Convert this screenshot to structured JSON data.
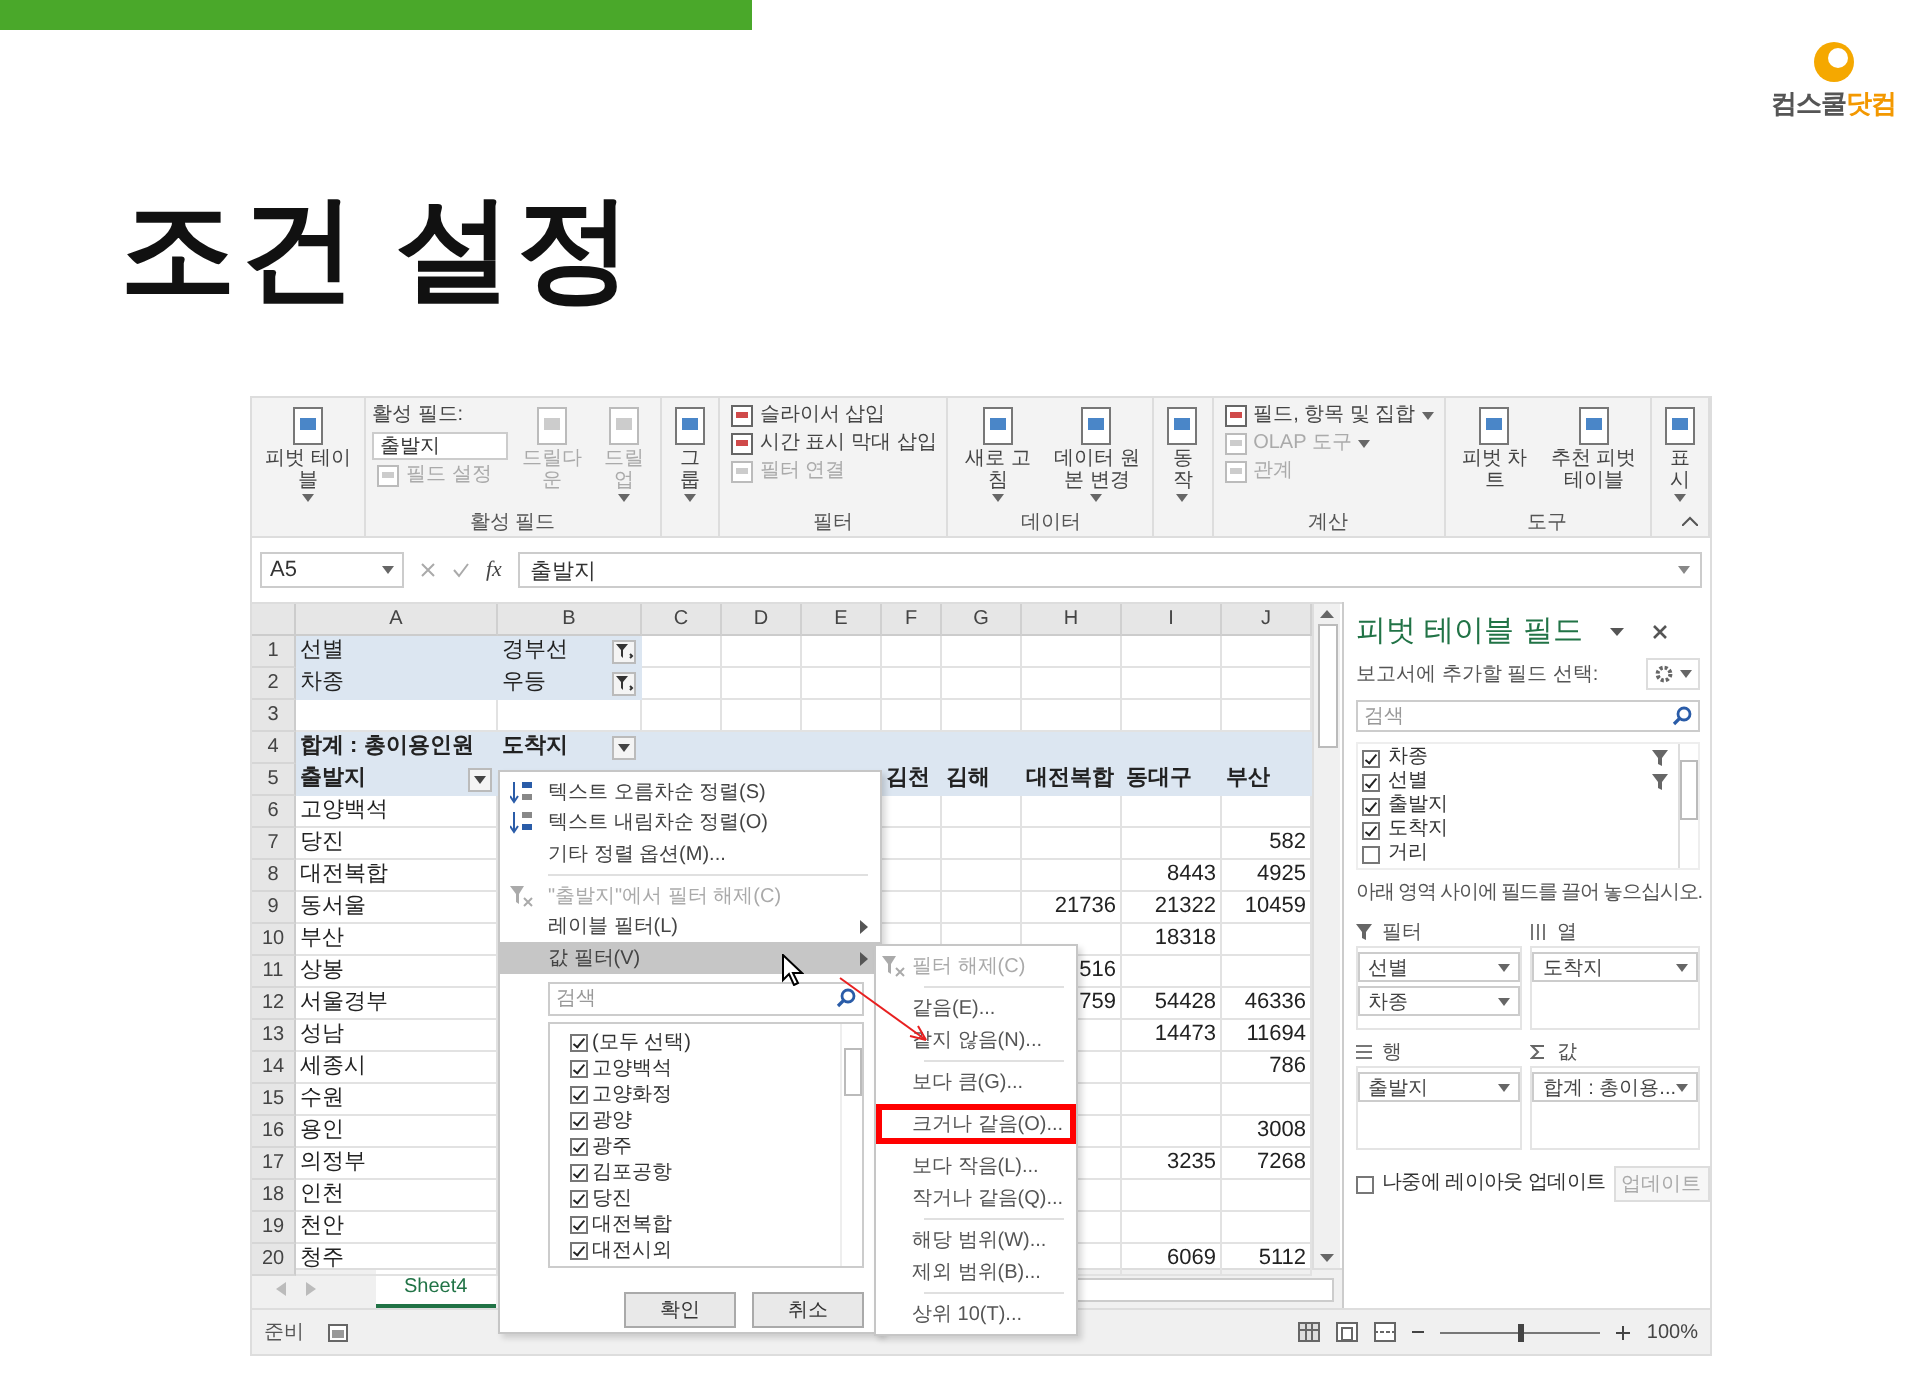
{
  "slide": {
    "title": "조건 설정",
    "logo": {
      "name": "컴스쿨",
      "accent": "닷컴"
    }
  },
  "ribbon": {
    "groups": [
      {
        "columns": [
          [
            {
              "kind": "large",
              "label": "피벗 테이블",
              "dropdown": true,
              "disabled": false
            }
          ]
        ]
      },
      {
        "label": "활성 필드",
        "columns": [
          [
            {
              "kind": "caption",
              "label": "활성 필드:"
            },
            {
              "kind": "field",
              "value": "출발지"
            },
            {
              "kind": "small",
              "label": "필드 설정",
              "dropdown": false,
              "disabled": true
            }
          ],
          [
            {
              "kind": "large",
              "label": "드릴다운",
              "dropdown": false,
              "disabled": true
            }
          ],
          [
            {
              "kind": "large",
              "label": "드릴업",
              "dropdown": true,
              "disabled": true
            }
          ]
        ]
      },
      {
        "columns": [
          [
            {
              "kind": "large",
              "label": "그룹",
              "dropdown": true,
              "disabled": false
            }
          ]
        ]
      },
      {
        "label": "필터",
        "columns": [
          [
            {
              "kind": "small",
              "label": "슬라이서 삽입",
              "dropdown": false,
              "disabled": false
            },
            {
              "kind": "small",
              "label": "시간 표시 막대 삽입",
              "dropdown": false,
              "disabled": false
            },
            {
              "kind": "small",
              "label": "필터 연결",
              "dropdown": false,
              "disabled": true
            }
          ]
        ]
      },
      {
        "label": "데이터",
        "columns": [
          [
            {
              "kind": "large",
              "label": "새로 고침",
              "dropdown": true,
              "disabled": false
            }
          ],
          [
            {
              "kind": "large",
              "label": "데이터 원본 변경",
              "dropdown": true,
              "disabled": false
            }
          ]
        ]
      },
      {
        "columns": [
          [
            {
              "kind": "large",
              "label": "동작",
              "dropdown": true,
              "disabled": false
            }
          ]
        ]
      },
      {
        "label": "계산",
        "columns": [
          [
            {
              "kind": "small",
              "label": "필드, 항목 및 집합",
              "dropdown": true,
              "disabled": false
            },
            {
              "kind": "small",
              "label": "OLAP 도구",
              "dropdown": true,
              "disabled": true
            },
            {
              "kind": "small",
              "label": "관계",
              "dropdown": false,
              "disabled": true
            }
          ]
        ]
      },
      {
        "label": "도구",
        "columns": [
          [
            {
              "kind": "large",
              "label": "피벗 차트",
              "dropdown": false,
              "disabled": false
            }
          ],
          [
            {
              "kind": "large",
              "label": "추천 피벗 테이블",
              "dropdown": false,
              "disabled": false
            }
          ]
        ]
      },
      {
        "columns": [
          [
            {
              "kind": "large",
              "label": "표시",
              "dropdown": true,
              "disabled": false
            }
          ]
        ]
      }
    ]
  },
  "formula_bar": {
    "name_box": "A5",
    "function_label": "fx",
    "formula": "출발지"
  },
  "sheet": {
    "columns": [
      "A",
      "B",
      "C",
      "D",
      "E",
      "F",
      "G",
      "H",
      "I",
      "J"
    ],
    "rows": [
      {
        "number": "1",
        "kind": "filter",
        "cells": [
          {
            "text": "선별"
          },
          {
            "text": "경부선",
            "dropdown": true,
            "filtered": true
          }
        ]
      },
      {
        "number": "2",
        "kind": "filter",
        "cells": [
          {
            "text": "차종"
          },
          {
            "text": "우등",
            "dropdown": true,
            "filtered": true
          }
        ]
      },
      {
        "number": "3",
        "kind": "blank",
        "cells": []
      },
      {
        "number": "4",
        "kind": "header",
        "cells": [
          {
            "text": "합계 : 총이용인원"
          },
          {
            "text": "도착지",
            "dropdown": true,
            "filtered": false
          }
        ]
      },
      {
        "number": "5",
        "kind": "header",
        "cells": [
          {
            "text": "출발지",
            "dropdown": true,
            "filtered": false
          },
          {},
          {},
          {},
          {},
          {
            "text": "김천"
          },
          {
            "text": "김해"
          },
          {
            "text": "대전복합"
          },
          {
            "text": "동대구"
          },
          {
            "text": "부산"
          }
        ]
      },
      {
        "number": "6",
        "kind": "data",
        "cells": [
          {
            "text": "고양백석"
          }
        ]
      },
      {
        "number": "7",
        "kind": "data",
        "cells": [
          {
            "text": "당진"
          },
          {},
          {},
          {},
          {},
          {},
          {},
          {},
          {},
          {
            "text": "582"
          }
        ]
      },
      {
        "number": "8",
        "kind": "data",
        "cells": [
          {
            "text": "대전복합"
          },
          {},
          {},
          {},
          {},
          {},
          {},
          {},
          {
            "text": "8443"
          },
          {
            "text": "4925"
          }
        ]
      },
      {
        "number": "9",
        "kind": "data",
        "cells": [
          {
            "text": "동서울"
          },
          {},
          {},
          {},
          {},
          {},
          {},
          {
            "text": "21736"
          },
          {
            "text": "21322"
          },
          {
            "text": "10459"
          }
        ]
      },
      {
        "number": "10",
        "kind": "data",
        "cells": [
          {
            "text": "부산"
          },
          {},
          {},
          {},
          {},
          {},
          {},
          {},
          {
            "text": "18318"
          }
        ]
      },
      {
        "number": "11",
        "kind": "data",
        "cells": [
          {
            "text": "상봉"
          },
          {},
          {},
          {},
          {},
          {},
          {},
          {
            "text": "516"
          }
        ]
      },
      {
        "number": "12",
        "kind": "data",
        "cells": [
          {
            "text": "서울경부"
          },
          {},
          {},
          {},
          {},
          {},
          {},
          {
            "text": "759"
          },
          {
            "text": "54428"
          },
          {
            "text": "46336"
          }
        ]
      },
      {
        "number": "13",
        "kind": "data",
        "cells": [
          {
            "text": "성남"
          },
          {},
          {},
          {},
          {},
          {},
          {},
          {},
          {
            "text": "14473"
          },
          {
            "text": "11694"
          }
        ]
      },
      {
        "number": "14",
        "kind": "data",
        "cells": [
          {
            "text": "세종시"
          },
          {},
          {},
          {},
          {},
          {},
          {},
          {},
          {},
          {
            "text": "786"
          }
        ]
      },
      {
        "number": "15",
        "kind": "data",
        "cells": [
          {
            "text": "수원"
          }
        ]
      },
      {
        "number": "16",
        "kind": "data",
        "cells": [
          {
            "text": "용인"
          },
          {},
          {},
          {},
          {},
          {},
          {},
          {},
          {},
          {
            "text": "3008"
          }
        ]
      },
      {
        "number": "17",
        "kind": "data",
        "cells": [
          {
            "text": "의정부"
          },
          {},
          {},
          {},
          {},
          {},
          {},
          {},
          {
            "text": "3235"
          },
          {
            "text": "7268"
          }
        ]
      },
      {
        "number": "18",
        "kind": "data",
        "cells": [
          {
            "text": "인천"
          }
        ]
      },
      {
        "number": "19",
        "kind": "data",
        "cells": [
          {
            "text": "천안"
          }
        ]
      },
      {
        "number": "20",
        "kind": "data",
        "cells": [
          {
            "text": "청주"
          },
          {},
          {},
          {},
          {},
          {},
          {},
          {},
          {
            "text": "6069"
          },
          {
            "text": "5112"
          }
        ]
      }
    ],
    "tabs": [
      {
        "label": "Sheet4",
        "selected": true
      }
    ]
  },
  "filter_menu": {
    "items": [
      {
        "kind": "ascending",
        "label": "텍스트 오름차순 정렬(S)",
        "disabled": false,
        "submenu": false,
        "selected": false
      },
      {
        "kind": "descending",
        "label": "텍스트 내림차순 정렬(O)",
        "disabled": false,
        "submenu": false,
        "selected": false
      },
      {
        "kind": "item",
        "label": "기타 정렬 옵션(M)...",
        "disabled": false,
        "submenu": false,
        "selected": false
      },
      {
        "kind": "separator"
      },
      {
        "kind": "clear",
        "label": "\"출발지\"에서 필터 해제(C)",
        "disabled": true,
        "submenu": false,
        "selected": false
      },
      {
        "kind": "item",
        "label": "레이블 필터(L)",
        "disabled": false,
        "submenu": true,
        "selected": false
      },
      {
        "kind": "item",
        "label": "값 필터(V)",
        "disabled": false,
        "submenu": true,
        "selected": true
      }
    ],
    "search_placeholder": "검색",
    "checklist": [
      {
        "label": "(모두 선택)",
        "checked": true
      },
      {
        "label": "고양백석",
        "checked": true
      },
      {
        "label": "고양화정",
        "checked": true
      },
      {
        "label": "광양",
        "checked": true
      },
      {
        "label": "광주",
        "checked": true
      },
      {
        "label": "김포공항",
        "checked": true
      },
      {
        "label": "당진",
        "checked": true
      },
      {
        "label": "대전복합",
        "checked": true
      },
      {
        "label": "대전시외",
        "checked": true
      }
    ],
    "buttons": [
      "확인",
      "취소"
    ]
  },
  "value_filter_submenu": {
    "items": [
      {
        "kind": "clear",
        "label": "필터 해제(C)",
        "disabled": true,
        "highlighted": false
      },
      {
        "kind": "separator"
      },
      {
        "kind": "item",
        "label": "같음(E)...",
        "disabled": false,
        "highlighted": false
      },
      {
        "kind": "item",
        "label": "같지 않음(N)...",
        "disabled": false,
        "highlighted": false
      },
      {
        "kind": "separator"
      },
      {
        "kind": "item",
        "label": "보다 큼(G)...",
        "disabled": false,
        "highlighted": false
      },
      {
        "kind": "item",
        "label": "크거나 같음(O)...",
        "disabled": false,
        "highlighted": true
      },
      {
        "kind": "item",
        "label": "보다 작음(L)...",
        "disabled": false,
        "highlighted": false
      },
      {
        "kind": "item",
        "label": "작거나 같음(Q)...",
        "disabled": false,
        "highlighted": false
      },
      {
        "kind": "separator"
      },
      {
        "kind": "item",
        "label": "해당 범위(W)...",
        "disabled": false,
        "highlighted": false
      },
      {
        "kind": "item",
        "label": "제외 범위(B)...",
        "disabled": false,
        "highlighted": false
      },
      {
        "kind": "separator"
      },
      {
        "kind": "item",
        "label": "상위 10(T)...",
        "disabled": false,
        "highlighted": false
      }
    ]
  },
  "pivot_pane": {
    "title": "피벗 테이블 필드",
    "subtitle": "보고서에 추가할 필드 선택:",
    "search_placeholder": "검색",
    "fields": [
      {
        "label": "차종",
        "checked": true,
        "filtered": true
      },
      {
        "label": "선별",
        "checked": true,
        "filtered": true
      },
      {
        "label": "출발지",
        "checked": true,
        "filtered": false
      },
      {
        "label": "도착지",
        "checked": true,
        "filtered": false
      },
      {
        "label": "거리",
        "checked": false,
        "filtered": false
      }
    ],
    "hint": "아래 영역 사이에 필드를 끌어 놓으십시오.",
    "areas": [
      {
        "kind": "filter",
        "label": "필터",
        "fields": [
          "선별",
          "차종"
        ]
      },
      {
        "kind": "columns",
        "label": "열",
        "fields": [
          "도착지"
        ]
      },
      {
        "kind": "rows",
        "label": "행",
        "fields": [
          "출발지"
        ]
      },
      {
        "kind": "values",
        "label": "값",
        "fields": [
          "합계 : 총이용..."
        ]
      }
    ],
    "defer": {
      "label": "나중에 레이아웃 업데이트",
      "checked": false
    },
    "update_button": {
      "label": "업데이트",
      "disabled": true
    }
  },
  "status_bar": {
    "ready": "준비",
    "zoom_slider": {
      "level": 0.5
    },
    "zoom": "100%"
  }
}
